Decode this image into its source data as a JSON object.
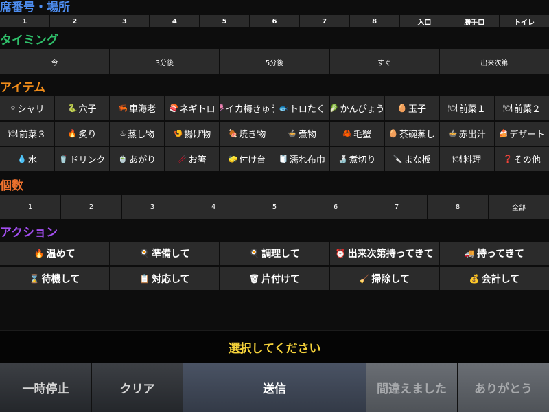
{
  "sections": {
    "seat": "席番号・場所",
    "timing": "タイミング",
    "item": "アイテム",
    "count": "個数",
    "action": "アクション"
  },
  "seats": [
    "1",
    "2",
    "3",
    "4",
    "5",
    "6",
    "7",
    "8",
    "入口",
    "勝手口",
    "トイレ"
  ],
  "timings": [
    "今",
    "3分後",
    "5分後",
    "すぐ",
    "出来次第"
  ],
  "items": [
    [
      {
        "icon": "⚪",
        "label": "シャリ"
      },
      {
        "icon": "🐍",
        "label": "穴子"
      },
      {
        "icon": "🦐",
        "label": "車海老"
      },
      {
        "icon": "🍣",
        "label": "ネギトロ"
      },
      {
        "icon": "🦑",
        "label": "イカ梅きゅう"
      },
      {
        "icon": "🐟",
        "label": "トロたく"
      },
      {
        "icon": "🥬",
        "label": "かんぴょう"
      },
      {
        "icon": "🥚",
        "label": "玉子"
      },
      {
        "icon": "🍽",
        "label": "前菜１"
      },
      {
        "icon": "🍽",
        "label": "前菜２"
      }
    ],
    [
      {
        "icon": "🍽",
        "label": "前菜３"
      },
      {
        "icon": "🔥",
        "label": "炙り"
      },
      {
        "icon": "♨",
        "label": "蒸し物"
      },
      {
        "icon": "🍤",
        "label": "揚げ物"
      },
      {
        "icon": "🍖",
        "label": "焼き物"
      },
      {
        "icon": "🍲",
        "label": "煮物"
      },
      {
        "icon": "🦀",
        "label": "毛蟹"
      },
      {
        "icon": "🥚",
        "label": "茶碗蒸し"
      },
      {
        "icon": "🍲",
        "label": "赤出汁"
      },
      {
        "icon": "🍰",
        "label": "デザート"
      }
    ],
    [
      {
        "icon": "💧",
        "label": "水"
      },
      {
        "icon": "🥤",
        "label": "ドリンク"
      },
      {
        "icon": "🍵",
        "label": "あがり"
      },
      {
        "icon": "🥢",
        "label": "お箸"
      },
      {
        "icon": "🧽",
        "label": "付け台"
      },
      {
        "icon": "🧻",
        "label": "濡れ布巾"
      },
      {
        "icon": "🍶",
        "label": "煮切り"
      },
      {
        "icon": "🔪",
        "label": "まな板"
      },
      {
        "icon": "🍽",
        "label": "料理"
      },
      {
        "icon": "❓",
        "label": "その他"
      }
    ]
  ],
  "counts": [
    "1",
    "2",
    "3",
    "4",
    "5",
    "6",
    "7",
    "8",
    "全部"
  ],
  "actions": [
    [
      {
        "icon": "🔥",
        "label": "温めて"
      },
      {
        "icon": "🍳",
        "label": "準備して"
      },
      {
        "icon": "🍳",
        "label": "調理して"
      },
      {
        "icon": "⏰",
        "label": "出来次第持ってきて"
      },
      {
        "icon": "🚚",
        "label": "持ってきて"
      }
    ],
    [
      {
        "icon": "⌛",
        "label": "待機して"
      },
      {
        "icon": "📋",
        "label": "対応して"
      },
      {
        "icon": "🗑",
        "label": "片付けて"
      },
      {
        "icon": "🧹",
        "label": "掃除して"
      },
      {
        "icon": "💰",
        "label": "会計して"
      }
    ]
  ],
  "status": "選択してください",
  "buttons": {
    "pause": "一時停止",
    "clear": "クリア",
    "send": "送信",
    "mistake": "間違えました",
    "thanks": "ありがとう"
  }
}
